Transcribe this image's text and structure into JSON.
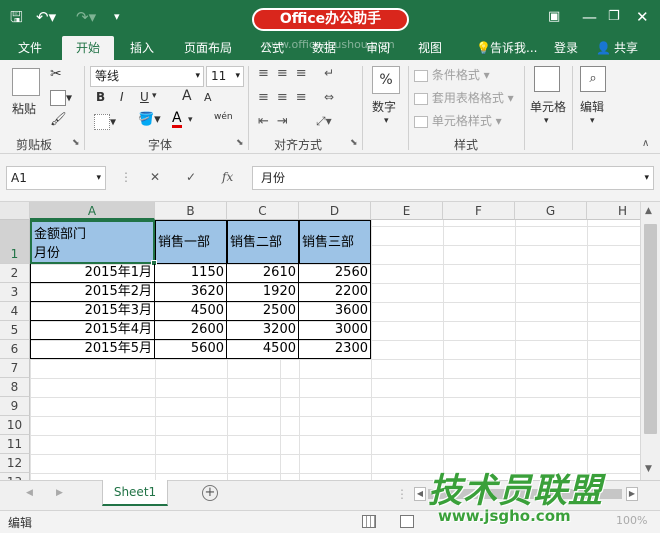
{
  "title_bar": {
    "logo_text": "Office办公助手"
  },
  "tabs": [
    "文件",
    "开始",
    "插入",
    "页面布局",
    "公式",
    "数据",
    "审阅",
    "视图"
  ],
  "tell_me": "告诉我...",
  "login": "登录",
  "share": "共享",
  "ribbon": {
    "clipboard": {
      "paste": "粘贴",
      "label": "剪贴板"
    },
    "font": {
      "name": "等线",
      "size": "11",
      "label": "字体",
      "bold": "B",
      "italic": "I",
      "underline": "U",
      "grow": "A",
      "shrink": "A",
      "color": "A",
      "phonetic": "wén"
    },
    "alignment": {
      "label": "对齐方式"
    },
    "number": {
      "btn": "数字",
      "icon": "%"
    },
    "styles": {
      "conditional": "条件格式",
      "table": "套用表格格式",
      "cell": "单元格样式",
      "label": "样式"
    },
    "cells": {
      "btn": "单元格"
    },
    "editing": {
      "btn": "编辑"
    }
  },
  "formula_bar": {
    "name_box": "A1",
    "content": "月份",
    "fx": "fx",
    "cancel": "✕",
    "enter": "✓"
  },
  "columns": [
    "A",
    "B",
    "C",
    "D",
    "E",
    "F",
    "G",
    "H"
  ],
  "rows": [
    "1",
    "2",
    "3",
    "4",
    "5",
    "6",
    "7",
    "8",
    "9",
    "10",
    "11",
    "12",
    "13"
  ],
  "header": {
    "a1_line1": "金额部门",
    "a1_line2": "月份",
    "b1": "销售一部",
    "c1": "销售二部",
    "d1": "销售三部"
  },
  "data_rows": [
    {
      "month": "2015年1月",
      "b": "1150",
      "c": "2610",
      "d": "2560"
    },
    {
      "month": "2015年2月",
      "b": "3620",
      "c": "1920",
      "d": "2200"
    },
    {
      "month": "2015年3月",
      "b": "4500",
      "c": "2500",
      "d": "3600"
    },
    {
      "month": "2015年4月",
      "b": "2600",
      "c": "3200",
      "d": "3000"
    },
    {
      "month": "2015年5月",
      "b": "5600",
      "c": "4500",
      "d": "2300"
    }
  ],
  "sheet_tab": "Sheet1",
  "status": {
    "mode": "编辑",
    "zoom": "100%"
  },
  "watermark": {
    "text": "技术员联盟",
    "url": "www.jsgho.com",
    "overlay_url": "www.officezhushou.com"
  },
  "colors": {
    "excel_green": "#217346",
    "header_fill": "#9dc3e6",
    "logo_red": "#d9261c",
    "watermark_green": "#3aa03a"
  }
}
